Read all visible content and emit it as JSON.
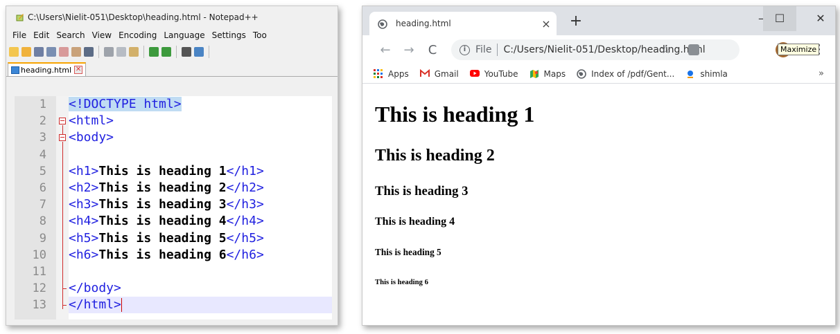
{
  "notepad": {
    "title": "C:\\Users\\Nielit-051\\Desktop\\heading.html - Notepad++",
    "menu": [
      "File",
      "Edit",
      "Search",
      "View",
      "Encoding",
      "Language",
      "Settings",
      "Too"
    ],
    "tab_label": "heading.html",
    "line_numbers": [
      "1",
      "2",
      "3",
      "4",
      "5",
      "6",
      "7",
      "8",
      "9",
      "10",
      "11",
      "12",
      "13"
    ],
    "code": {
      "l1": "<!DOCTYPE html>",
      "l2": "<html>",
      "l3": "<body>",
      "h1_open": "<h1>",
      "h1_text": "This is heading 1",
      "h1_close": "</h1>",
      "h2_open": "<h2>",
      "h2_text": "This is heading 2",
      "h2_close": "</h2>",
      "h3_open": "<h3>",
      "h3_text": "This is heading 3",
      "h3_close": "</h3>",
      "h4_open": "<h4>",
      "h4_text": "This is heading 4",
      "h4_close": "</h4>",
      "h5_open": "<h5>",
      "h5_text": "This is heading 5",
      "h5_close": "</h5>",
      "h6_open": "<h6>",
      "h6_text": "This is heading 6",
      "h6_close": "</h6>",
      "l12": "</body>",
      "l13": "</html>"
    },
    "colors": {
      "tag": "#2121e0",
      "fold_marker": "#d02c2c",
      "active_tab_accent": "#f7a300"
    }
  },
  "chrome": {
    "tab_title": "heading.html",
    "tab_close": "×",
    "new_tab": "+",
    "window_buttons": {
      "minimize": "–",
      "maximize": "☐",
      "close": "✕"
    },
    "tooltip": "Maximize",
    "address": {
      "scheme_label": "File",
      "url": "C:/Users/Nielit-051/Desktop/heading.html"
    },
    "bookmarks": [
      "Apps",
      "Gmail",
      "YouTube",
      "Maps",
      "Index of /pdf/Gent...",
      "shimla"
    ],
    "bookmarks_more": "»",
    "page": {
      "h1": "This is heading 1",
      "h2": "This is heading 2",
      "h3": "This is heading 3",
      "h4": "This is heading 4",
      "h5": "This is heading 5",
      "h6": "This is heading 6"
    }
  }
}
